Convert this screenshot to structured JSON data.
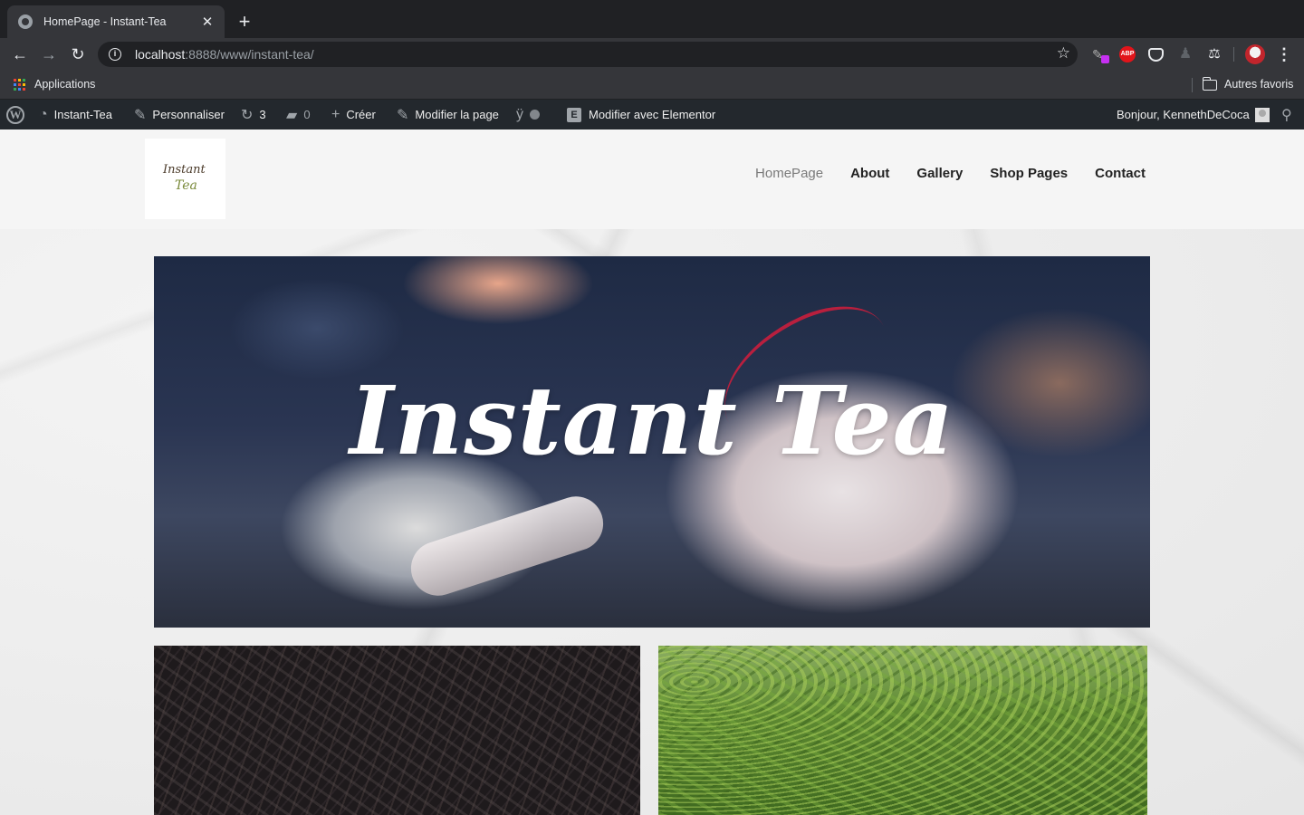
{
  "browser": {
    "tab_title": "HomePage - Instant-Tea",
    "url_host": "localhost",
    "url_path": ":8888/www/instant-tea/",
    "bookmarks": {
      "apps_label": "Applications",
      "other_label": "Autres favoris"
    }
  },
  "adminbar": {
    "site_name": "Instant-Tea",
    "customize": "Personnaliser",
    "updates_count": "3",
    "comments_count": "0",
    "new_label": "Créer",
    "edit_page": "Modifier la page",
    "elementor": "Modifier avec Elementor",
    "greeting": "Bonjour, KennethDeCoca"
  },
  "site": {
    "logo_line1": "Instant",
    "logo_line2": "Tea",
    "nav": [
      "HomePage",
      "About",
      "Gallery",
      "Shop Pages",
      "Contact"
    ],
    "active_nav": "HomePage",
    "hero_title": "Instant Tea"
  },
  "colors": {
    "chrome_dark": "#202124",
    "chrome_toolbar": "#35363a",
    "adminbar": "#23282d",
    "abp_red": "#e2141a"
  }
}
